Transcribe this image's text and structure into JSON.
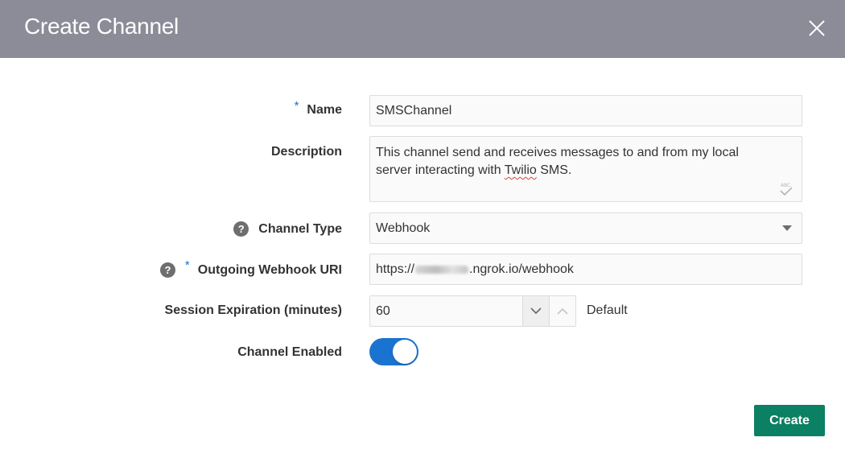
{
  "dialog": {
    "title": "Create Channel",
    "close_icon": "close-icon"
  },
  "form": {
    "name": {
      "label": "Name",
      "required_marker": "*",
      "value": "SMSChannel"
    },
    "description": {
      "label": "Description",
      "value_line1": "This channel send and receives messages to and from my local",
      "value_line2_before": "server interacting with ",
      "value_line2_misspelled": "Twilio",
      "value_line2_after": " SMS.",
      "spellcheck_icon": "spellcheck-icon"
    },
    "channel_type": {
      "label": "Channel Type",
      "help_icon": "?",
      "selected": "Webhook"
    },
    "outgoing_webhook_uri": {
      "label": "Outgoing Webhook URI",
      "help_icon": "?",
      "required_marker": "*",
      "value_prefix": "https://",
      "value_suffix": ".ngrok.io/webhook"
    },
    "session_expiration": {
      "label": "Session Expiration (minutes)",
      "value": "60",
      "default_label": "Default"
    },
    "channel_enabled": {
      "label": "Channel Enabled",
      "enabled": true
    }
  },
  "actions": {
    "create_label": "Create"
  },
  "colors": {
    "header_bg": "#8b8c98",
    "accent_blue": "#1a73d0",
    "create_green": "#0b8063",
    "required_star": "#1d73c9"
  }
}
